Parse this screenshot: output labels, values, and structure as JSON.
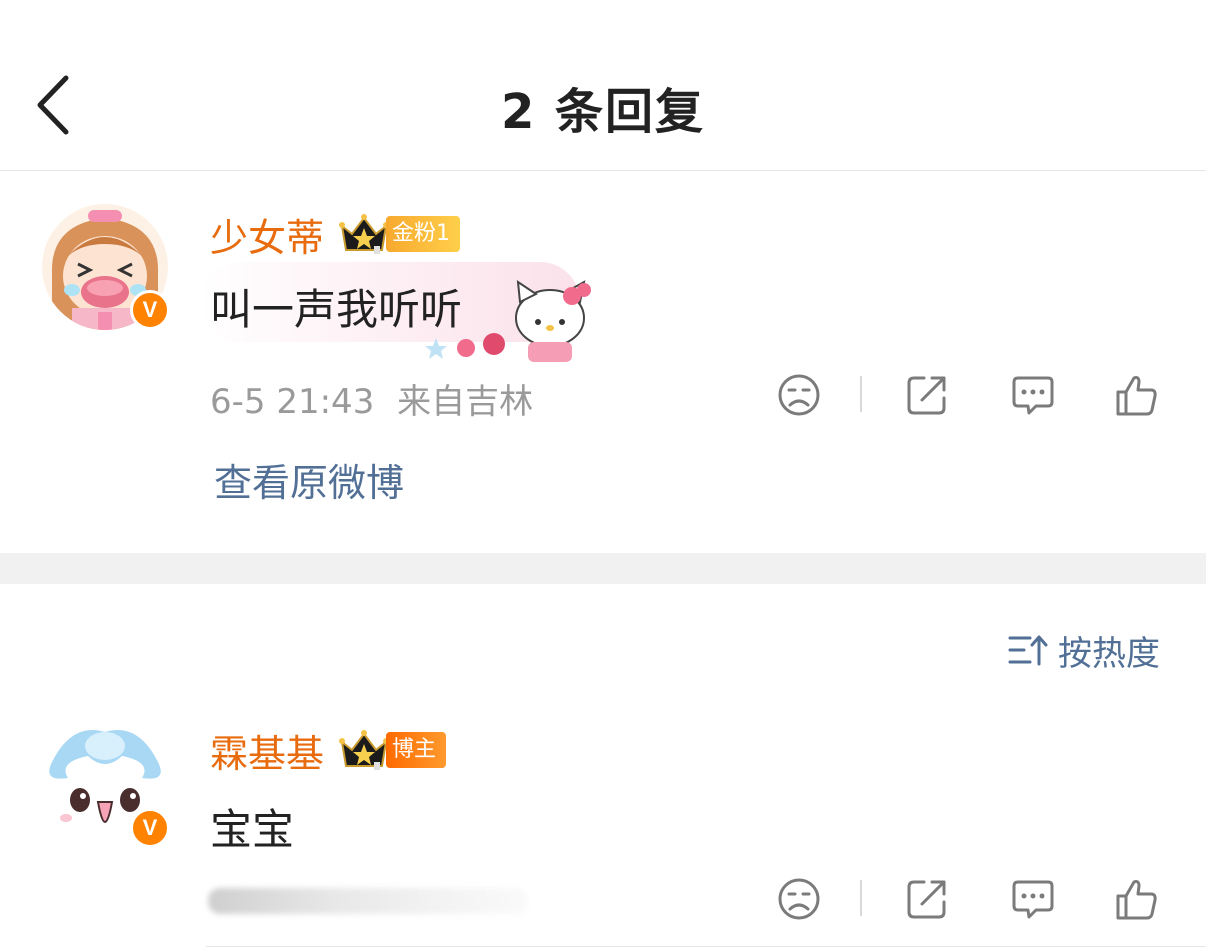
{
  "header": {
    "title": "2 条回复",
    "back_icon": "chevron-left-icon"
  },
  "comments": [
    {
      "username": "少女蒂",
      "badge": "金粉1",
      "text": "叫一声我听听",
      "time": "6-5 21:43",
      "location": "来自吉林",
      "view_origin": "查看原微博",
      "verified": "V"
    },
    {
      "username": "霖基基",
      "badge": "博主",
      "text": "宝宝",
      "verified": "V"
    }
  ],
  "sort": {
    "label": "按热度",
    "icon": "sort-icon"
  },
  "colors": {
    "username": "#e86b0e",
    "link": "#526f96",
    "meta": "#9a9a9a",
    "verified": "#ff8200"
  }
}
